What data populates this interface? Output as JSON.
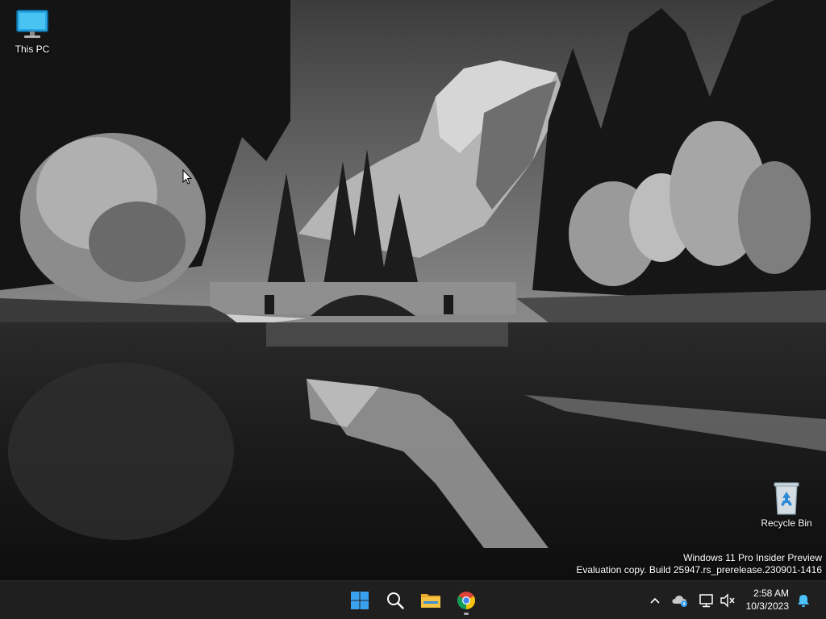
{
  "desktop": {
    "icons": [
      {
        "label": "This PC"
      },
      {
        "label": "Recycle Bin"
      }
    ]
  },
  "watermark": {
    "line1": "Windows 11 Pro Insider Preview",
    "line2": "Evaluation copy. Build 25947.rs_prerelease.230901-1416"
  },
  "taskbar": {
    "apps": [
      {
        "name": "start-icon"
      },
      {
        "name": "search-icon"
      },
      {
        "name": "file-explorer-icon"
      },
      {
        "name": "chrome-icon"
      }
    ],
    "tray": {
      "time": "2:58 AM",
      "date": "10/3/2023"
    }
  },
  "colors": {
    "taskbar_bg": "#1f1f1f",
    "start_blue": "#3aa0f0",
    "folder_yellow": "#f5c242",
    "notification_blue": "#4cc2ff"
  }
}
